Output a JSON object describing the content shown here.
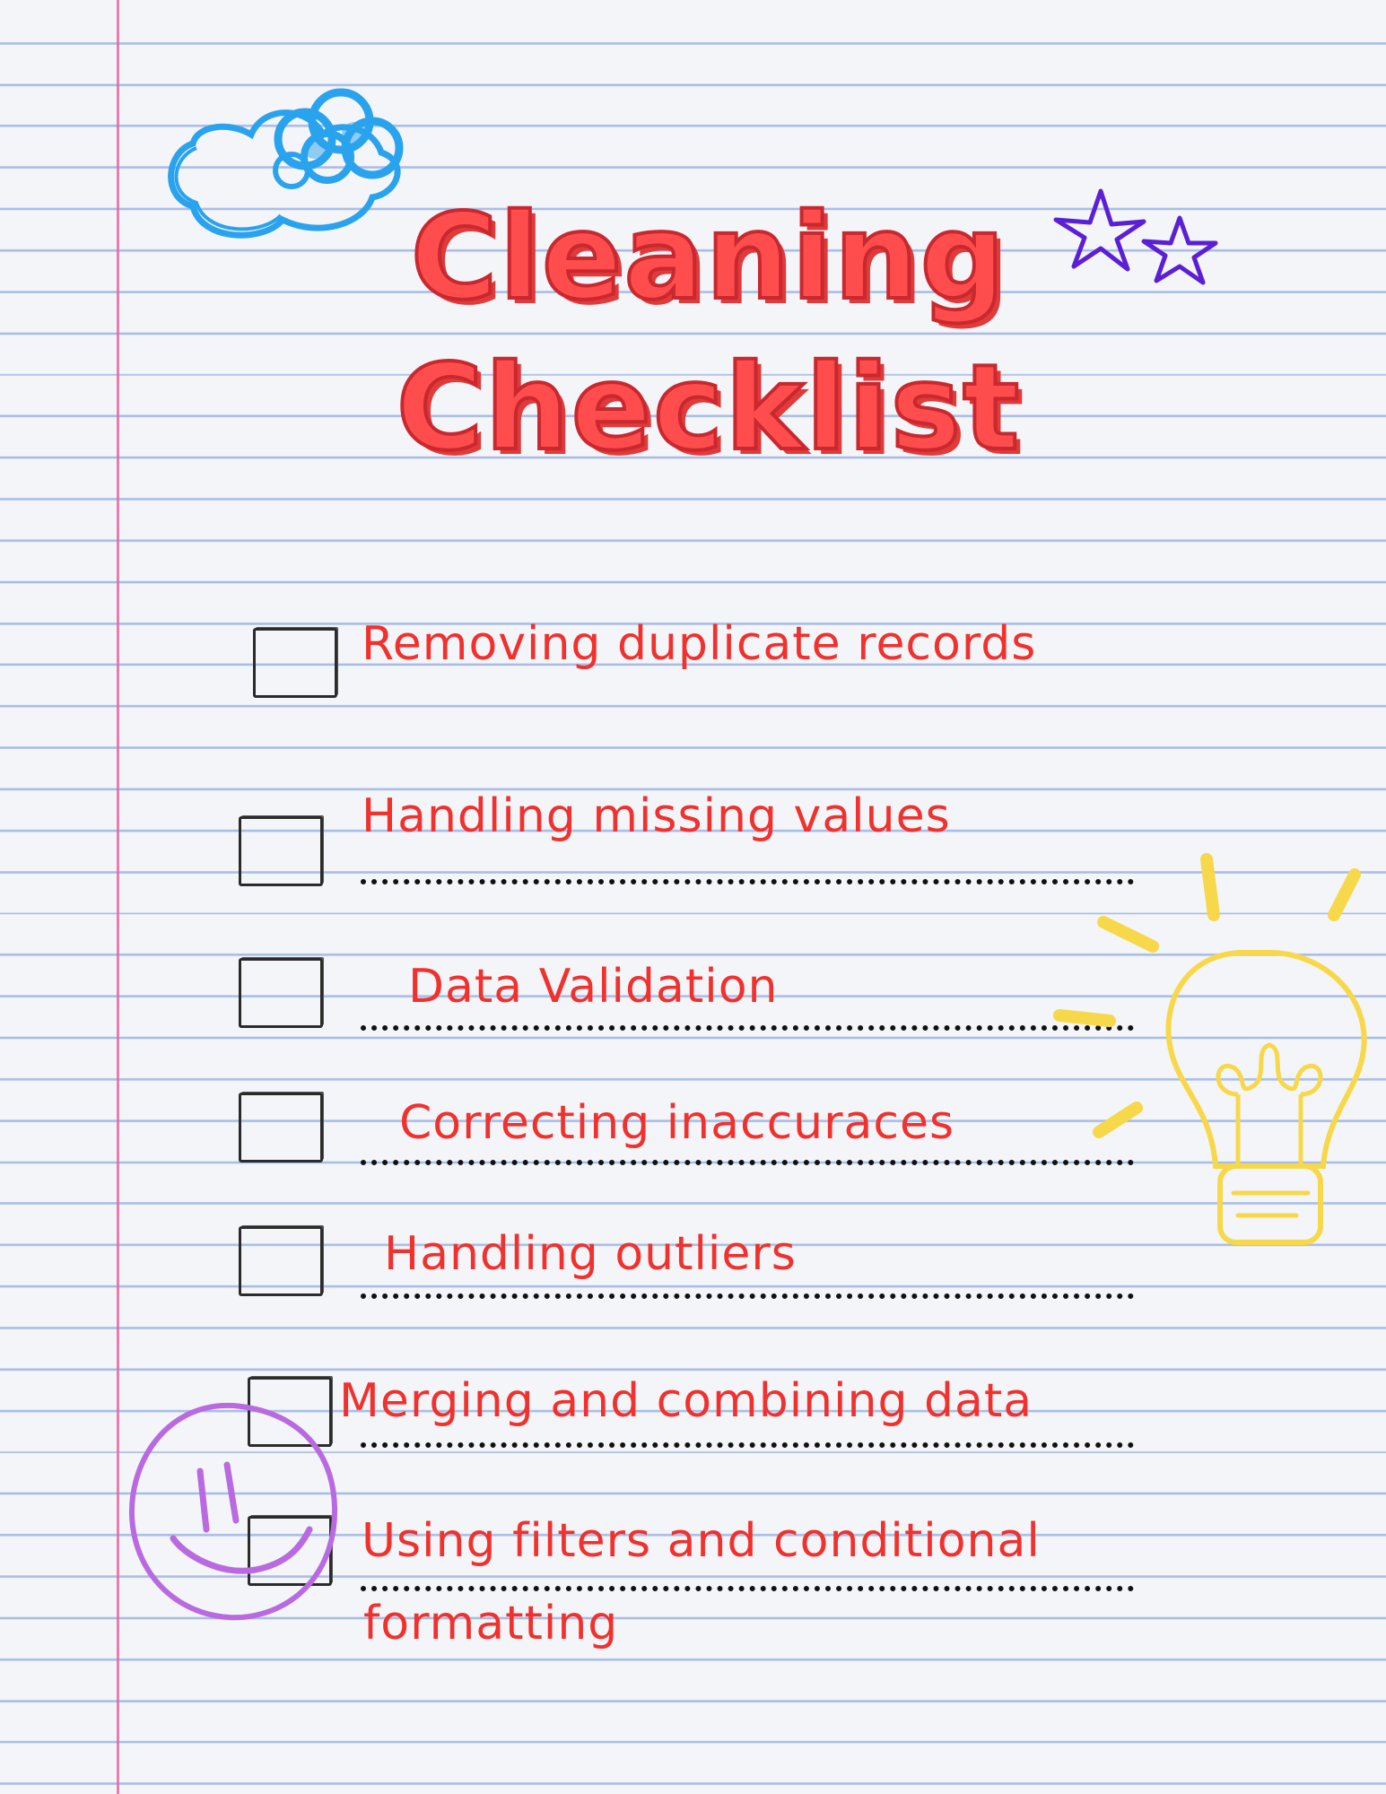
{
  "title": {
    "line1": "Cleaning",
    "line2": "Checklist"
  },
  "checklist": {
    "items": [
      {
        "label": "Removing duplicate records",
        "checked": false
      },
      {
        "label": "Handling missing values",
        "checked": false
      },
      {
        "label": "Data Validation",
        "checked": false
      },
      {
        "label": "Correcting inaccuraces",
        "checked": false
      },
      {
        "label": "Handling  outliers",
        "checked": false
      },
      {
        "label": "Merging and combining data",
        "checked": false
      },
      {
        "label": "Using filters and conditional",
        "label_line2": "formatting",
        "checked": false
      }
    ]
  },
  "decorations": {
    "icons": [
      "cloud-icon",
      "stars-icon",
      "lightbulb-icon",
      "smiley-icon"
    ],
    "colors": {
      "title": "#ff4d4d",
      "item_text": "#f0312e",
      "cloud": "#2aa3ee",
      "stars": "#5b1fd6",
      "lightbulb": "#f7d84a",
      "smiley": "#b96ae0",
      "margin_line": "#e26aa6",
      "ruled_line": "#a8bde6"
    }
  }
}
